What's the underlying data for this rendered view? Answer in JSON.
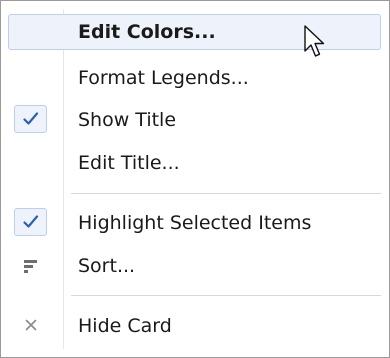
{
  "menu": {
    "items": [
      {
        "label": "Edit Colors...",
        "checked": false,
        "hovered": true,
        "bold": true,
        "icon": ""
      },
      {
        "label": "Format Legends...",
        "checked": false,
        "hovered": false,
        "bold": false,
        "icon": ""
      },
      {
        "label": "Show Title",
        "checked": true,
        "hovered": false,
        "bold": false,
        "icon": "checkmark-icon"
      },
      {
        "label": "Edit Title...",
        "checked": false,
        "hovered": false,
        "bold": false,
        "icon": ""
      },
      {
        "label": "Highlight Selected Items",
        "checked": true,
        "hovered": false,
        "bold": false,
        "icon": "checkmark-icon"
      },
      {
        "label": "Sort...",
        "checked": false,
        "hovered": false,
        "bold": false,
        "icon": "sort-icon"
      },
      {
        "label": "Hide Card",
        "checked": false,
        "hovered": false,
        "bold": false,
        "icon": "close-icon"
      }
    ]
  },
  "colors": {
    "checkmark": "#2b5fb4",
    "hover_bg": "#eef3fb",
    "hover_border": "#bcd0ee",
    "icon_gray": "#6e6e6e",
    "separator": "#d8d8d8"
  },
  "cursor": {
    "icon": "mouse-pointer-icon"
  }
}
